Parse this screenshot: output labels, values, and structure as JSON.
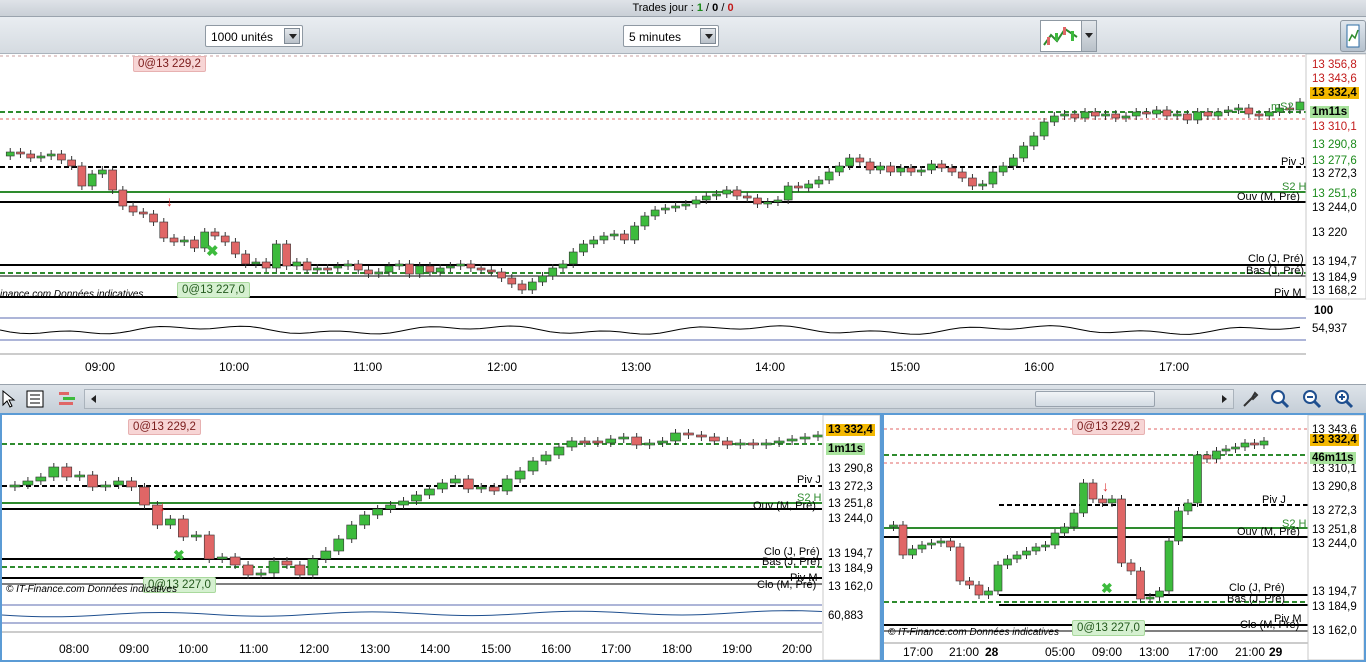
{
  "topbar": {
    "label": "Trades jour : ",
    "v1": "1",
    "sep1": " / ",
    "v2": "0",
    "sep2": " / ",
    "v3": "0"
  },
  "toolbar": {
    "quantity": "1000 unités",
    "interval": "5 minutes"
  },
  "colors": {
    "bull": "#3dbb3d",
    "bear": "#e06666",
    "pivot_green": "#2e8b2e",
    "accent_blue": "#5b9bd5"
  },
  "main": {
    "order_top": "0@13 229,2",
    "order_bottom": "0@13 227,0",
    "copyright": "inance.com",
    "copyright_note": "Données indicatives",
    "price_labels": [
      "13 356,8",
      "13 343,6",
      "13 310,1",
      "13 290,8",
      "13 277,6",
      "13 272,3",
      "13 251,8",
      "13 244,0",
      "13 220",
      "13 194,7",
      "13 184,9",
      "13 168,2"
    ],
    "price_current": "13 332,4",
    "timer": "1m11s",
    "line_labels": {
      "piv_j": "Piv J",
      "s2h": "S2 H",
      "ouv_m": "Ouv (M, Pré)",
      "clo_j": "Clo (J, Pré)",
      "bas_j": "Bas (J, Pré)",
      "piv_m": "Piv M",
      "ms2": "mS2"
    },
    "indicator_top": "100",
    "indicator_value": "54,937",
    "times": [
      "09:00",
      "10:00",
      "11:00",
      "12:00",
      "13:00",
      "14:00",
      "15:00",
      "16:00",
      "17:00"
    ]
  },
  "bottom_left": {
    "order_top": "0@13 229,2",
    "order_bottom": "0@13 227,0",
    "copyright": "© IT-Finance.com",
    "copyright_note": "Données indicatives",
    "price_current": "13 332,4",
    "timer": "1m11s",
    "price_labels": [
      "13 290,8",
      "13 272,3",
      "13 251,8",
      "13 244,0",
      "13 194,7",
      "13 184,9",
      "13 162,0"
    ],
    "line_labels": {
      "piv_j": "Piv J",
      "s2h": "S2 H",
      "ouv_m": "Ouv (M, Pré)",
      "clo_j": "Clo (J, Pré)",
      "bas_j": "Bas (J, Pré)",
      "piv_m": "Piv M",
      "clo_m": "Clo (M, Pré)"
    },
    "indicator_value": "60,883",
    "times": [
      "08:00",
      "09:00",
      "10:00",
      "11:00",
      "12:00",
      "13:00",
      "14:00",
      "15:00",
      "16:00",
      "17:00",
      "18:00",
      "19:00",
      "20:00"
    ]
  },
  "bottom_right": {
    "order_top": "0@13 229,2",
    "order_bottom": "0@13 227,0",
    "copyright": "© IT-Finance.com",
    "copyright_note": "Données indicatives",
    "price_current": "13 332,4",
    "timer": "46m11s",
    "price_labels": [
      "13 343,6",
      "13 310,1",
      "13 290,8",
      "13 272,3",
      "13 251,8",
      "13 244,0",
      "13 194,7",
      "13 184,9",
      "13 162,0"
    ],
    "line_labels": {
      "piv_j": "Piv J",
      "s2h": "S2 H",
      "ouv_m": "Ouv (M, Pré)",
      "clo_j": "Clo (J, Pré)",
      "bas_j": "Bas (J, Pré)",
      "piv_m": "Piv M",
      "clo_m": "Clo (M, Pré)"
    },
    "times": [
      "17:00",
      "21:00",
      "28",
      "05:00",
      "09:00",
      "13:00",
      "17:00",
      "21:00",
      "29"
    ]
  }
}
